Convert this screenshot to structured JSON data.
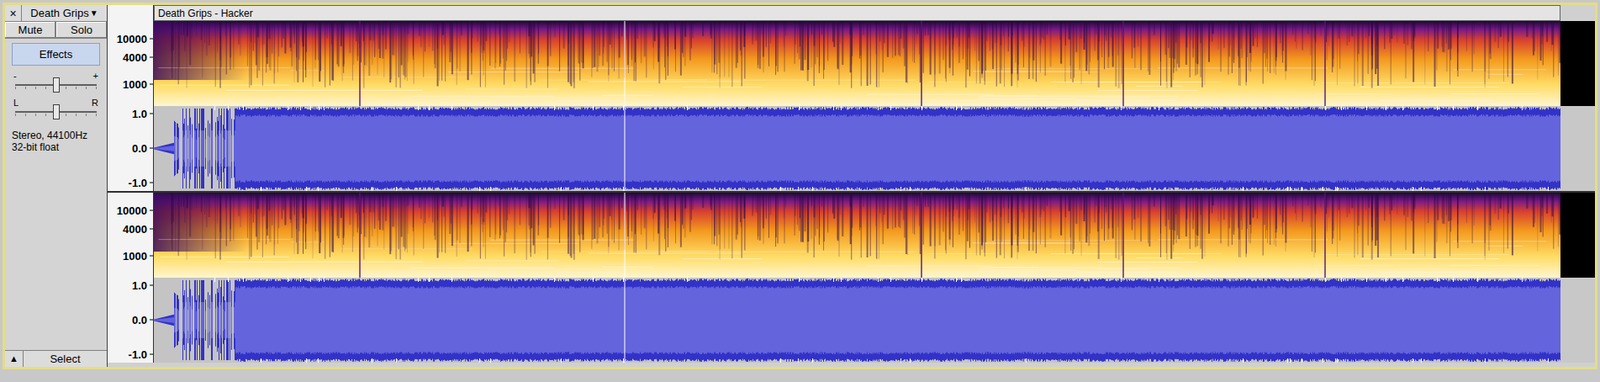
{
  "track": {
    "close": "×",
    "name": "Death Grips",
    "menu": "▼",
    "mute": {
      "label": "Mute",
      "pressed": false
    },
    "solo": {
      "label": "Solo",
      "pressed": false
    },
    "effects": "Effects",
    "gain": {
      "minus": "-",
      "plus": "+",
      "level": 0.5
    },
    "pan": {
      "left": "L",
      "right": "R",
      "level": 0.5
    },
    "info": [
      "Stereo, 44100Hz",
      "32-bit float"
    ],
    "collapse": "▲",
    "select": "Select"
  },
  "clip": {
    "title": "Death Grips - Hacker"
  },
  "channels": [
    {
      "spectrogram_ticks": [
        "10000",
        "4000",
        "1000"
      ],
      "waveform_ticks": [
        "1.0",
        "0.0",
        "-1.0"
      ]
    },
    {
      "spectrogram_ticks": [
        "10000",
        "4000",
        "1000"
      ],
      "waveform_ticks": [
        "1.0",
        "0.0",
        "-1.0"
      ]
    }
  ]
}
